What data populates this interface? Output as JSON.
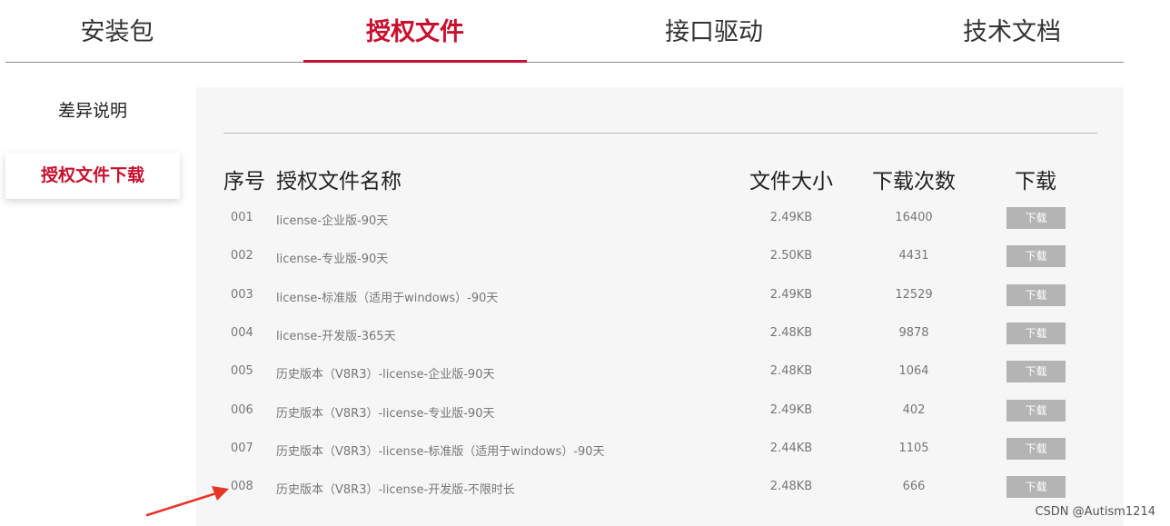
{
  "tabs": [
    {
      "label": "安装包",
      "active": false
    },
    {
      "label": "授权文件",
      "active": true
    },
    {
      "label": "接口驱动",
      "active": false
    },
    {
      "label": "技术文档",
      "active": false
    }
  ],
  "sidebar": {
    "items": [
      {
        "label": "差异说明",
        "active": false
      },
      {
        "label": "授权文件下载",
        "active": true
      }
    ]
  },
  "table": {
    "headers": {
      "no": "序号",
      "name": "授权文件名称",
      "size": "文件大小",
      "count": "下载次数",
      "download": "下载"
    },
    "rows": [
      {
        "no": "001",
        "name": "license-企业版-90天",
        "size": "2.49KB",
        "count": "16400",
        "button": "下载"
      },
      {
        "no": "002",
        "name": "license-专业版-90天",
        "size": "2.50KB",
        "count": "4431",
        "button": "下载"
      },
      {
        "no": "003",
        "name": "license-标准版（适用于windows）-90天",
        "size": "2.49KB",
        "count": "12529",
        "button": "下载"
      },
      {
        "no": "004",
        "name": "license-开发版-365天",
        "size": "2.48KB",
        "count": "9878",
        "button": "下载"
      },
      {
        "no": "005",
        "name": "历史版本（V8R3）-license-企业版-90天",
        "size": "2.48KB",
        "count": "1064",
        "button": "下载"
      },
      {
        "no": "006",
        "name": "历史版本（V8R3）-license-专业版-90天",
        "size": "2.49KB",
        "count": "402",
        "button": "下载"
      },
      {
        "no": "007",
        "name": "历史版本（V8R3）-license-标准版（适用于windows）-90天",
        "size": "2.44KB",
        "count": "1105",
        "button": "下载"
      },
      {
        "no": "008",
        "name": "历史版本（V8R3）-license-开发版-不限时长",
        "size": "2.48KB",
        "count": "666",
        "button": "下载"
      }
    ]
  },
  "annotation": {
    "arrow_color": "#e8352a"
  },
  "watermark": "CSDN @Autism1214",
  "colors": {
    "accent": "#c8102e",
    "button_bg": "#b4b4b4"
  }
}
